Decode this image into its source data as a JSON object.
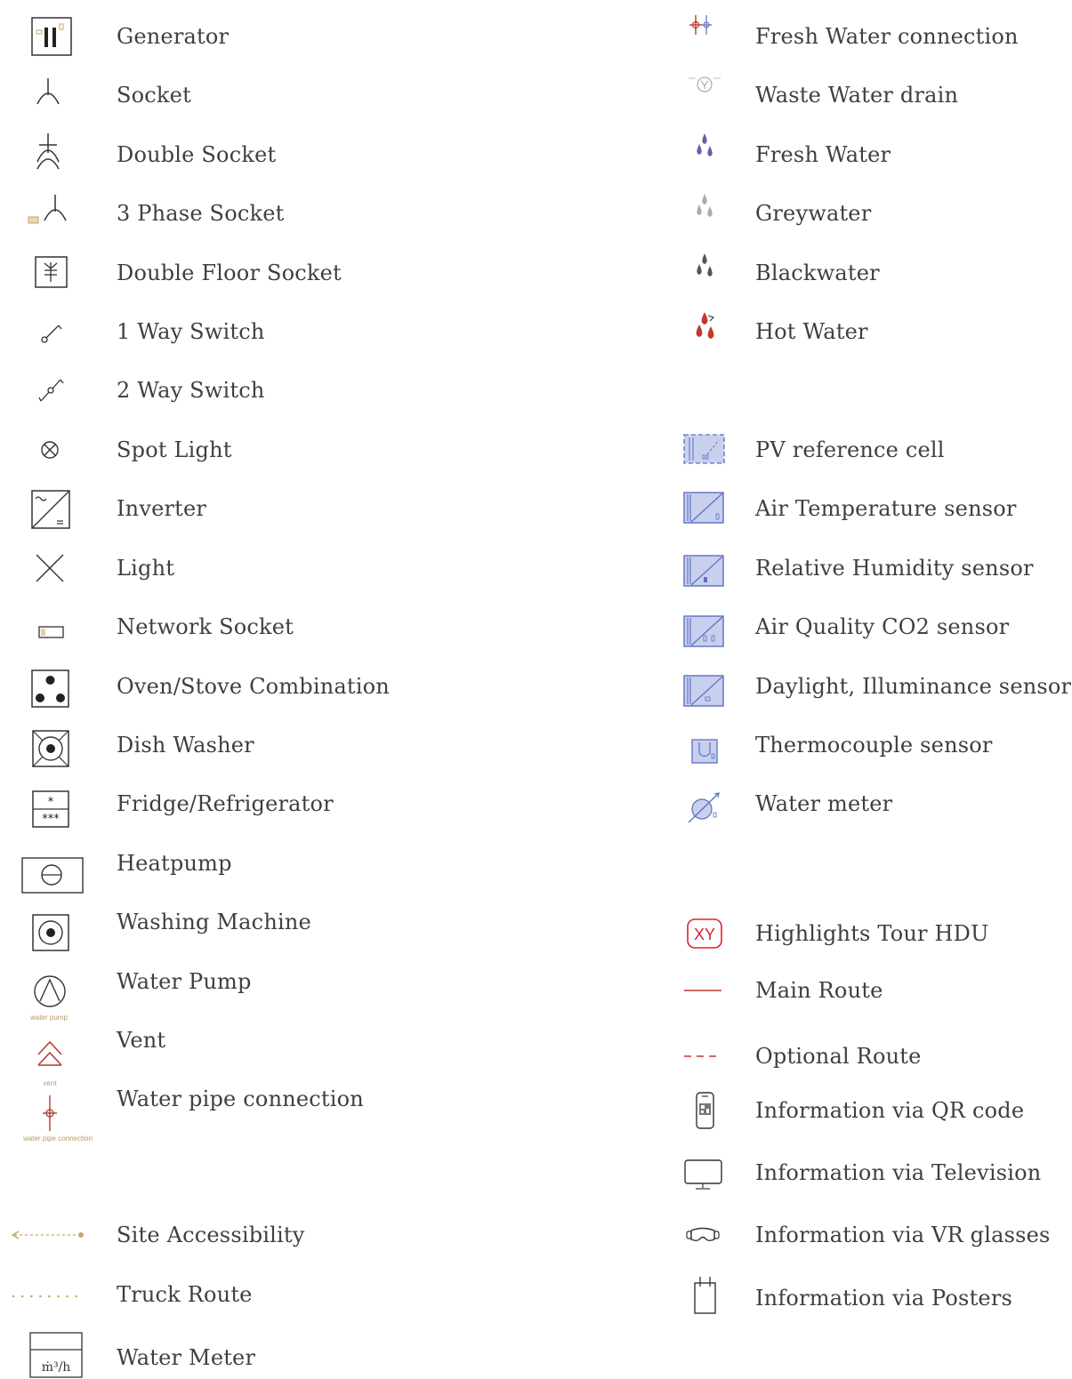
{
  "colors": {
    "line": "#333333",
    "accent_tan": "#c8a46a",
    "red": "#c0392b",
    "tour_red": "#e0202c",
    "blue": "#5b6fc4",
    "blue_fill": "#c9d0ee",
    "purple": "#6f5aa8",
    "grey_drop": "#a9a9b3",
    "dark_drop": "#555555"
  },
  "legend_left": [
    {
      "icon": "generator-icon",
      "label": "Generator"
    },
    {
      "icon": "socket-icon",
      "label": "Socket"
    },
    {
      "icon": "double-socket-icon",
      "label": "Double Socket"
    },
    {
      "icon": "three-phase-socket-icon",
      "label": "3 Phase Socket"
    },
    {
      "icon": "double-floor-socket-icon",
      "label": "Double Floor Socket"
    },
    {
      "icon": "one-way-switch-icon",
      "label": "1 Way Switch"
    },
    {
      "icon": "two-way-switch-icon",
      "label": "2 Way Switch"
    },
    {
      "icon": "spot-light-icon",
      "label": "Spot Light"
    },
    {
      "icon": "inverter-icon",
      "label": "Inverter"
    },
    {
      "icon": "light-icon",
      "label": "Light"
    },
    {
      "icon": "network-socket-icon",
      "label": "Network Socket"
    },
    {
      "icon": "oven-stove-icon",
      "label": "Oven/Stove Combination"
    },
    {
      "icon": "dish-washer-icon",
      "label": "Dish Washer"
    },
    {
      "icon": "fridge-icon",
      "label": "Fridge/Refrigerator"
    },
    {
      "icon": "heatpump-icon",
      "label": "Heatpump"
    },
    {
      "icon": "washing-machine-icon",
      "label": "Washing Machine"
    },
    {
      "icon": "water-pump-icon",
      "label": "Water Pump",
      "caption": "water pump"
    },
    {
      "icon": "vent-icon",
      "label": "Vent",
      "caption": "vent"
    },
    {
      "icon": "water-pipe-connection-icon",
      "label": "Water pipe connection",
      "caption": "water pipe connection"
    },
    {
      "icon": "site-accessibility-icon",
      "label": "Site Accessibility"
    },
    {
      "icon": "truck-route-icon",
      "label": "Truck Route"
    },
    {
      "icon": "water-meter-box-icon",
      "label": "Water Meter",
      "unit": "ṁ³/h"
    }
  ],
  "legend_right": [
    {
      "icon": "fresh-water-connection-icon",
      "label": "Fresh Water connection"
    },
    {
      "icon": "waste-water-drain-icon",
      "label": "Waste Water drain"
    },
    {
      "icon": "fresh-water-icon",
      "label": "Fresh Water"
    },
    {
      "icon": "greywater-icon",
      "label": "Greywater"
    },
    {
      "icon": "blackwater-icon",
      "label": "Blackwater"
    },
    {
      "icon": "hot-water-icon",
      "label": "Hot Water"
    },
    {
      "icon": "pv-reference-cell-icon",
      "label": "PV reference cell"
    },
    {
      "icon": "air-temperature-sensor-icon",
      "label": "Air Temperature sensor"
    },
    {
      "icon": "relative-humidity-sensor-icon",
      "label": "Relative Humidity sensor"
    },
    {
      "icon": "air-quality-co2-sensor-icon",
      "label": "Air Quality CO2 sensor"
    },
    {
      "icon": "daylight-illuminance-sensor-icon",
      "label": "Daylight, Illuminance sensor"
    },
    {
      "icon": "thermocouple-sensor-icon",
      "label": "Thermocouple sensor"
    },
    {
      "icon": "water-meter-icon",
      "label": "Water meter"
    },
    {
      "icon": "highlights-tour-icon",
      "label": "Highlights Tour HDU",
      "badge": "XY"
    },
    {
      "icon": "main-route-icon",
      "label": "Main Route"
    },
    {
      "icon": "optional-route-icon",
      "label": "Optional Route"
    },
    {
      "icon": "qr-code-icon",
      "label": "Information via QR code"
    },
    {
      "icon": "television-icon",
      "label": "Information via Television"
    },
    {
      "icon": "vr-glasses-icon",
      "label": "Information via VR glasses"
    },
    {
      "icon": "posters-icon",
      "label": "Information via Posters"
    }
  ]
}
